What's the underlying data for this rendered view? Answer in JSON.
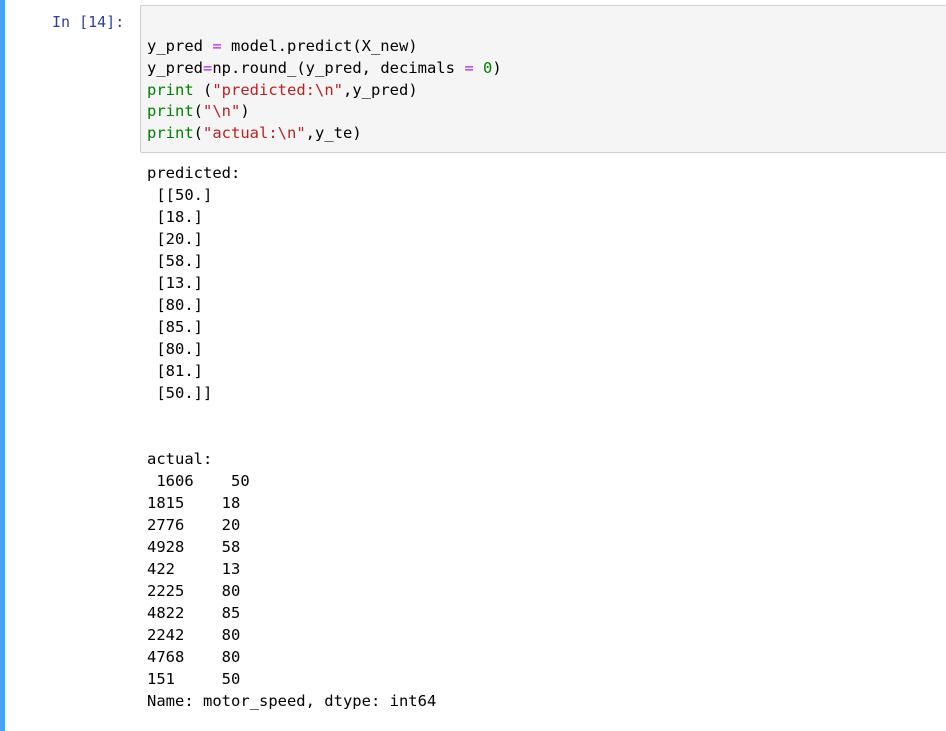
{
  "cell": {
    "prompt": "In [14]:",
    "code_lines": [
      "y_pred = model.predict(X_new)",
      "y_pred=np.round_(y_pred, decimals = 0)",
      "print (\"predicted:\\n\",y_pred)",
      "print(\"\\n\")",
      "print(\"actual:\\n\",y_te)"
    ],
    "output_text": "predicted:\n [[50.]\n [18.]\n [20.]\n [58.]\n [13.]\n [80.]\n [85.]\n [80.]\n [81.]\n [50.]]\n\n\nactual:\n 1606    50\n1815    18\n2776    20\n4928    58\n422     13\n2225    80\n4822    85\n2242    80\n4768    80\n151     50\nName: motor_speed, dtype: int64"
  },
  "colors": {
    "cell_bar": "#42a5f5",
    "prompt": "#303f9f",
    "operator": "#aa22ff",
    "builtin": "#008000",
    "string": "#ba2121",
    "number": "#008000",
    "input_background": "#f5f5f5"
  }
}
